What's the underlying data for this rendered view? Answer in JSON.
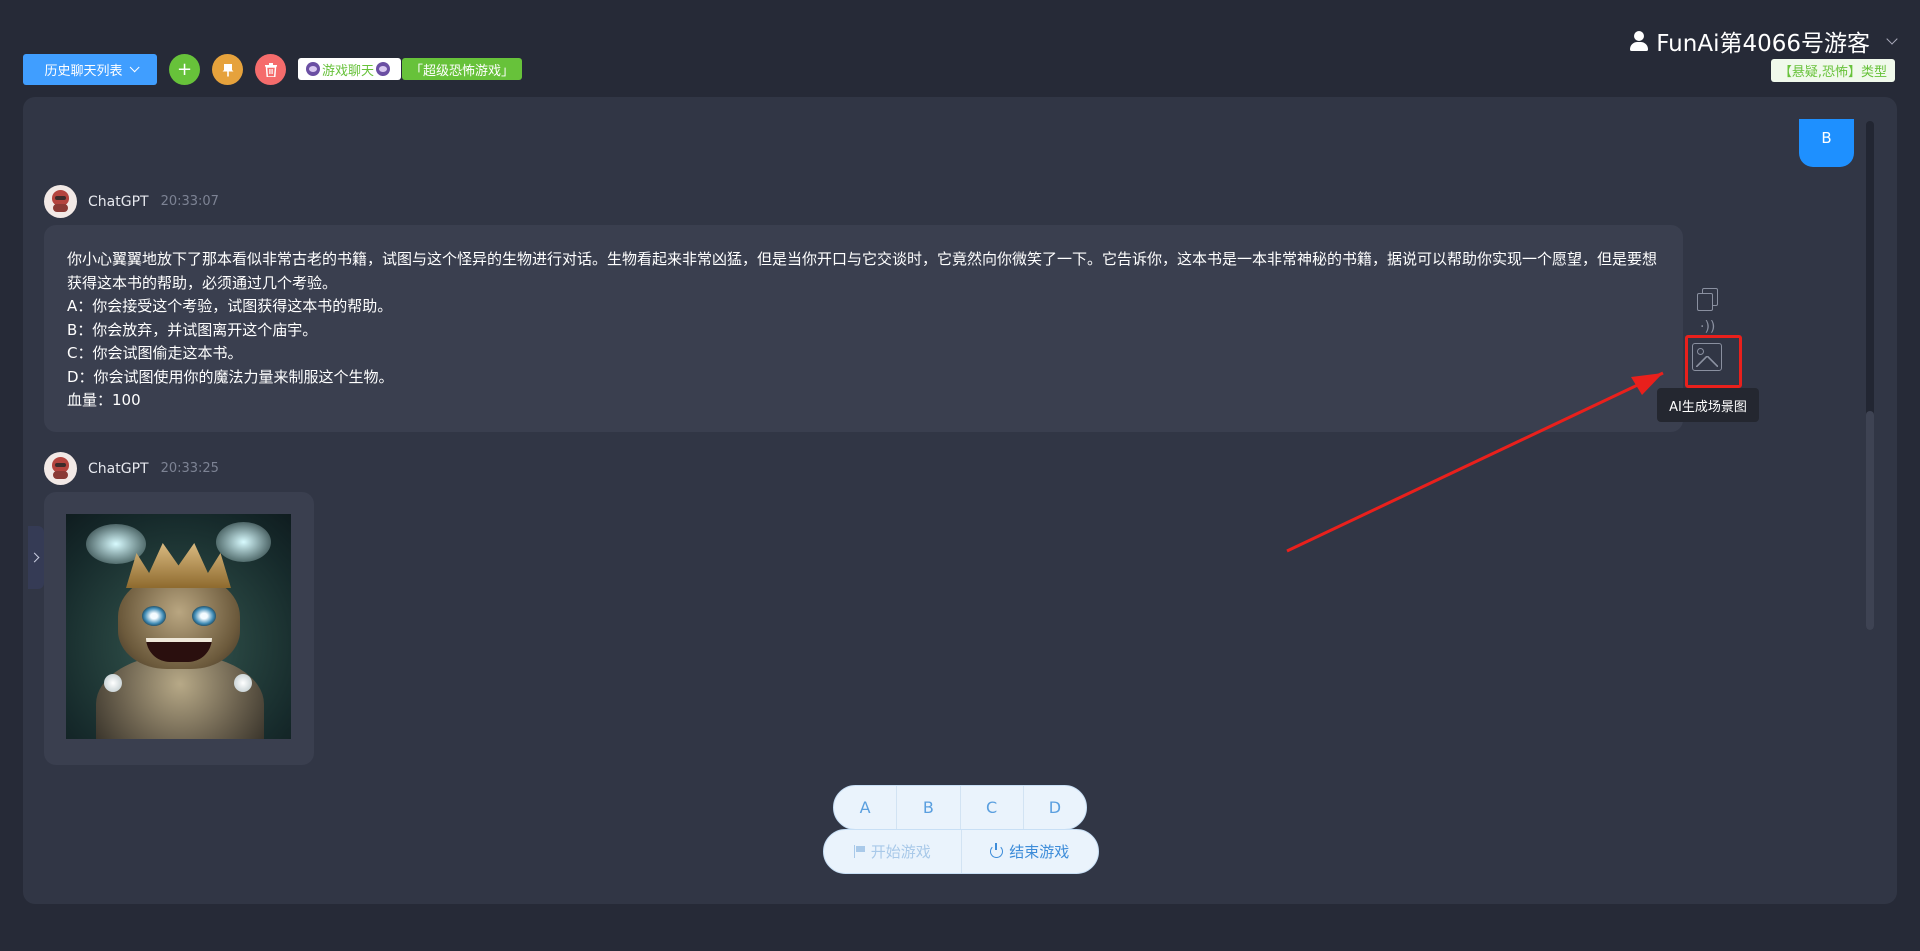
{
  "header": {
    "history_label": "历史聊天列表",
    "add_label": "+",
    "game_tag": "游戏聊天",
    "mode_tag": "「超级恐怖游戏」",
    "user_name": "FunAi第4066号游客",
    "type_tag": "【悬疑,恐怖】类型"
  },
  "chat": {
    "user_message": "B",
    "messages": [
      {
        "sender": "ChatGPT",
        "time": "20:33:07",
        "lines": [
          "你小心翼翼地放下了那本看似非常古老的书籍，试图与这个怪异的生物进行对话。生物看起来非常凶猛，但是当你开口与它交谈时，它竟然向你微笑了一下。它告诉你，这本书是一本非常神秘的书籍，据说可以帮助你实现一个愿望，但是要想获得这本书的帮助，必须通过几个考验。",
          "A：你会接受这个考验，试图获得这本书的帮助。",
          "B：你会放弃，并试图离开这个庙宇。",
          "C：你会试图偷走这本书。",
          "D：你会试图使用你的魔法力量来制服这个生物。",
          "血量：100"
        ]
      },
      {
        "sender": "ChatGPT",
        "time": "20:33:25"
      }
    ],
    "tooltip": "AI生成场景图"
  },
  "options": [
    "A",
    "B",
    "C",
    "D"
  ],
  "controls": {
    "start_label": "开始游戏",
    "end_label": "结束游戏"
  },
  "colors": {
    "primary": "#409eff",
    "success": "#67c23a",
    "warning": "#e6a23c",
    "danger": "#f56c6c",
    "annotation": "#e9201c"
  }
}
